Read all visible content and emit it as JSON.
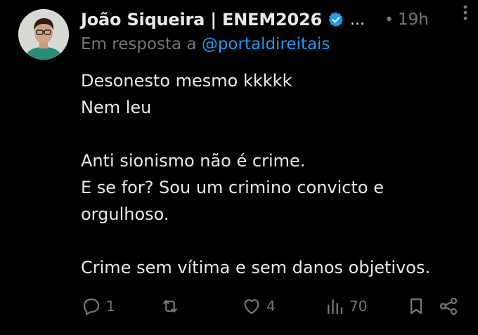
{
  "author": {
    "display_name": "João Siqueira | ENEM2026",
    "truncation": "...",
    "dot": "•",
    "time": "19h"
  },
  "reply": {
    "prefix": "Em resposta a",
    "handle": "@portaldireitais"
  },
  "post": {
    "lines": [
      "Desonesto mesmo kkkkk",
      "Nem leu",
      "",
      "Anti sionismo não é crime.",
      "E se for? Sou um crimino convicto e",
      "orgulhoso.",
      "",
      "Crime sem vítima e sem danos objetivos."
    ]
  },
  "actions": {
    "reply_count": "1",
    "repost_count": "",
    "like_count": "4",
    "view_count": "70"
  },
  "colors": {
    "background": "#000000",
    "text": "#e7e9ea",
    "muted": "#71767b",
    "accent": "#1d9bf0"
  },
  "icons": [
    "avatar",
    "verified-badge-icon",
    "more-options-icon",
    "reply-icon",
    "repost-icon",
    "like-icon",
    "views-icon",
    "bookmark-icon",
    "share-icon"
  ]
}
